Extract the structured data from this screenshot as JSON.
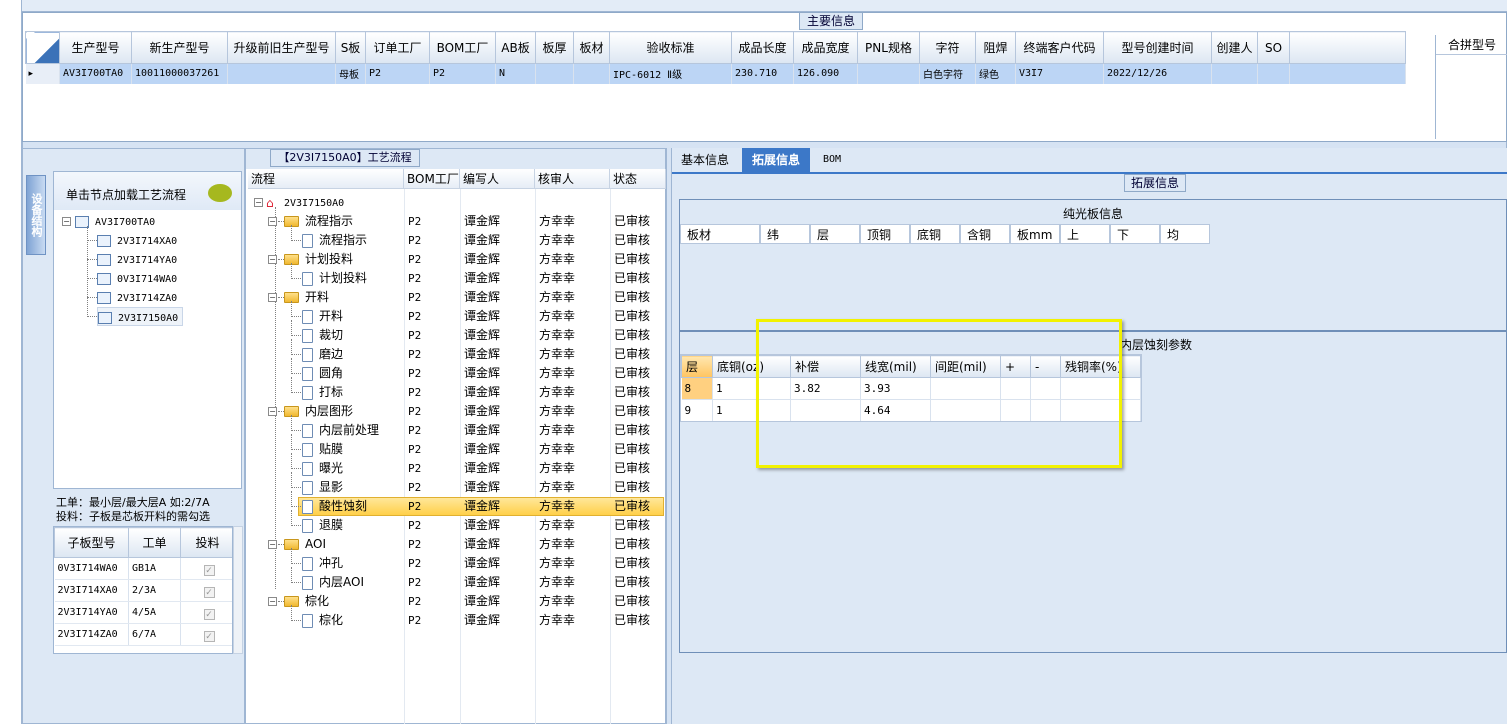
{
  "main_info": {
    "title": "主要信息",
    "merge_title": "合拼型号",
    "columns": [
      "生产型号",
      "新生产型号",
      "升级前旧生产型号",
      "S板",
      "订单工厂",
      "BOM工厂",
      "AB板",
      "板厚",
      "板材",
      "验收标准",
      "成品长度",
      "成品宽度",
      "PNL规格",
      "字符",
      "阻焊",
      "终端客户代码",
      "型号创建时间",
      "创建人",
      "SO"
    ],
    "row": [
      "AV3I700TA0",
      "10011000037261",
      "",
      "母板",
      "P2",
      "P2",
      "N",
      "",
      "",
      "IPC-6012 Ⅱ级",
      "230.710",
      "126.090",
      "",
      "白色字符",
      "绿色",
      "V3I7",
      "2022/12/26",
      "",
      ""
    ],
    "row_marker": "▸"
  },
  "device_panel": {
    "vertical_tab": "设备结构",
    "load_label": "单击节点加载工艺流程",
    "tree_root": "AV3I700TA0",
    "tree_children": [
      "2V3I714XA0",
      "2V3I714YA0",
      "0V3I714WA0",
      "2V3I714ZA0",
      "2V3I7150A0"
    ],
    "note_line1": "工单：最小层/最大层A 如:2/7A",
    "note_line2": "投料：子板是芯板开料的需勾选",
    "sub_columns": [
      "子板型号",
      "工单",
      "投料"
    ],
    "sub_rows": [
      [
        "0V3I714WA0",
        "GB1A",
        "✓"
      ],
      [
        "2V3I714XA0",
        "2/3A",
        "✓"
      ],
      [
        "2V3I714YA0",
        "4/5A",
        "✓"
      ],
      [
        "2V3I714ZA0",
        "6/7A",
        "✓"
      ]
    ]
  },
  "process": {
    "title": "【2V3I7150A0】工艺流程",
    "columns": [
      "流程",
      "BOM工厂",
      "编写人",
      "核审人",
      "状态"
    ],
    "root": "2V3I7150A0",
    "rows": [
      {
        "name": "流程指示",
        "level": 1,
        "bom": "P2",
        "writer": "谭金辉",
        "reviewer": "方幸幸",
        "status": "已审核"
      },
      {
        "name": "流程指示",
        "level": 2,
        "bom": "P2",
        "writer": "谭金辉",
        "reviewer": "方幸幸",
        "status": "已审核"
      },
      {
        "name": "计划投料",
        "level": 1,
        "bom": "P2",
        "writer": "谭金辉",
        "reviewer": "方幸幸",
        "status": "已审核"
      },
      {
        "name": "计划投料",
        "level": 2,
        "bom": "P2",
        "writer": "谭金辉",
        "reviewer": "方幸幸",
        "status": "已审核"
      },
      {
        "name": "开料",
        "level": 1,
        "bom": "P2",
        "writer": "谭金辉",
        "reviewer": "方幸幸",
        "status": "已审核"
      },
      {
        "name": "开料",
        "level": 2,
        "bom": "P2",
        "writer": "谭金辉",
        "reviewer": "方幸幸",
        "status": "已审核"
      },
      {
        "name": "裁切",
        "level": 2,
        "bom": "P2",
        "writer": "谭金辉",
        "reviewer": "方幸幸",
        "status": "已审核"
      },
      {
        "name": "磨边",
        "level": 2,
        "bom": "P2",
        "writer": "谭金辉",
        "reviewer": "方幸幸",
        "status": "已审核"
      },
      {
        "name": "圆角",
        "level": 2,
        "bom": "P2",
        "writer": "谭金辉",
        "reviewer": "方幸幸",
        "status": "已审核"
      },
      {
        "name": "打标",
        "level": 2,
        "bom": "P2",
        "writer": "谭金辉",
        "reviewer": "方幸幸",
        "status": "已审核"
      },
      {
        "name": "内层图形",
        "level": 1,
        "bom": "P2",
        "writer": "谭金辉",
        "reviewer": "方幸幸",
        "status": "已审核"
      },
      {
        "name": "内层前处理",
        "level": 2,
        "bom": "P2",
        "writer": "谭金辉",
        "reviewer": "方幸幸",
        "status": "已审核"
      },
      {
        "name": "贴膜",
        "level": 2,
        "bom": "P2",
        "writer": "谭金辉",
        "reviewer": "方幸幸",
        "status": "已审核"
      },
      {
        "name": "曝光",
        "level": 2,
        "bom": "P2",
        "writer": "谭金辉",
        "reviewer": "方幸幸",
        "status": "已审核"
      },
      {
        "name": "显影",
        "level": 2,
        "bom": "P2",
        "writer": "谭金辉",
        "reviewer": "方幸幸",
        "status": "已审核"
      },
      {
        "name": "酸性蚀刻",
        "level": 2,
        "bom": "P2",
        "writer": "谭金辉",
        "reviewer": "方幸幸",
        "status": "已审核",
        "selected": true
      },
      {
        "name": "退膜",
        "level": 2,
        "bom": "P2",
        "writer": "谭金辉",
        "reviewer": "方幸幸",
        "status": "已审核"
      },
      {
        "name": "AOI",
        "level": 1,
        "bom": "P2",
        "writer": "谭金辉",
        "reviewer": "方幸幸",
        "status": "已审核"
      },
      {
        "name": "冲孔",
        "level": 2,
        "bom": "P2",
        "writer": "谭金辉",
        "reviewer": "方幸幸",
        "status": "已审核"
      },
      {
        "name": "内层AOI",
        "level": 2,
        "bom": "P2",
        "writer": "谭金辉",
        "reviewer": "方幸幸",
        "status": "已审核"
      },
      {
        "name": "棕化",
        "level": 1,
        "bom": "P2",
        "writer": "谭金辉",
        "reviewer": "方幸幸",
        "status": "已审核"
      },
      {
        "name": "棕化",
        "level": 2,
        "bom": "P2",
        "writer": "谭金辉",
        "reviewer": "方幸幸",
        "status": "已审核"
      }
    ]
  },
  "right_panel": {
    "tabs": [
      "基本信息",
      "拓展信息",
      "BOM"
    ],
    "active_tab": 1,
    "ext_title": "拓展信息",
    "bare_board_title": "纯光板信息",
    "bare_columns": [
      "板材",
      "纬",
      "层",
      "顶铜",
      "底铜",
      "含铜",
      "板mm",
      "上",
      "下",
      "均"
    ],
    "etch_title": "内层蚀刻参数",
    "etch_columns": [
      "层",
      "底铜(oz)",
      "补偿",
      "线宽(mil)",
      "间距(mil)",
      "+",
      "-",
      "残铜率(%)"
    ],
    "etch_rows": [
      [
        "8",
        "1",
        "3.82",
        "3.93",
        "",
        "",
        "",
        ""
      ],
      [
        "9",
        "1",
        "",
        "4.64",
        "",
        "",
        "",
        ""
      ]
    ]
  },
  "colors": {
    "highlight_box": "#f2f200",
    "selected_row": "#ffd95a",
    "active_tab": "#3c78c8"
  }
}
